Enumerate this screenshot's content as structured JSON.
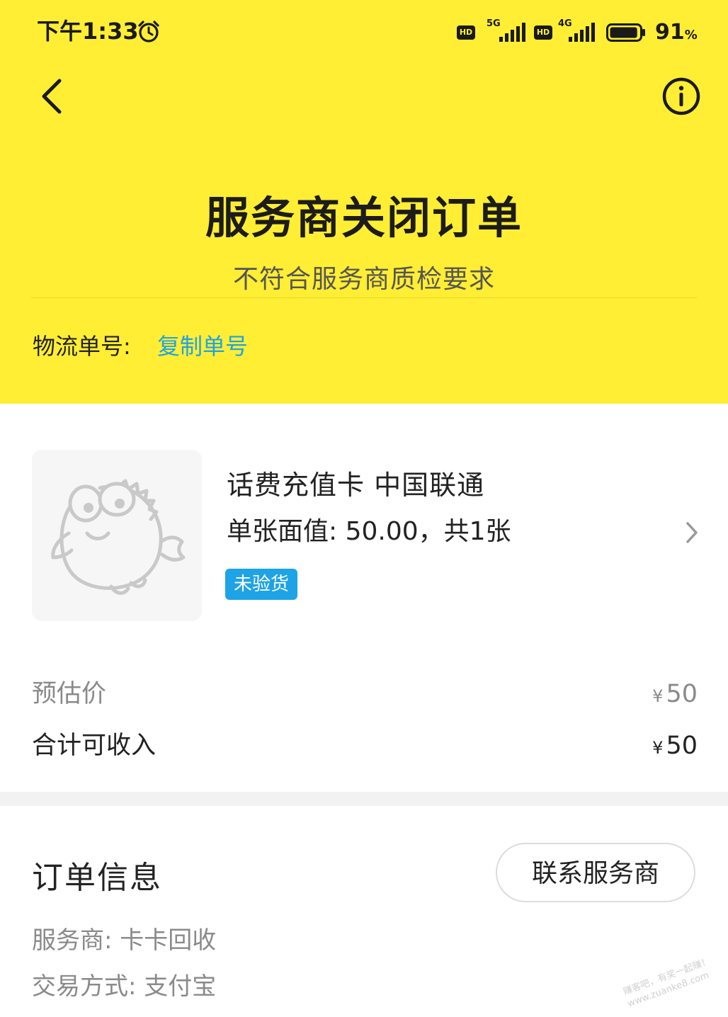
{
  "status_bar": {
    "time": "下午1:33",
    "network_1": "5G",
    "network_2": "4G",
    "hd_badge": "HD",
    "battery_percent": "91",
    "battery_unit": "%",
    "battery_level": 0.91
  },
  "header": {
    "title": "服务商关闭订单",
    "subtitle": "不符合服务商质检要求",
    "logistics_label": "物流单号:",
    "copy_label": "复制单号",
    "background_color": "#ffee33",
    "link_color": "#1ea3e6"
  },
  "product": {
    "name": "话费充值卡 中国联通",
    "description": "单张面值: 50.00，共1张",
    "status_badge": "未验货",
    "thumbnail_icon": "fish-mascot-placeholder-icon"
  },
  "pricing": {
    "estimate_label": "预估价",
    "estimate_currency": "¥",
    "estimate_value": "50",
    "total_label": "合计可收入",
    "total_currency": "¥",
    "total_value": "50"
  },
  "order_info": {
    "title": "订单信息",
    "contact_button": "联系服务商",
    "provider": "服务商: 卡卡回收",
    "payment_method": "交易方式: 支付宝"
  },
  "watermark": {
    "line1": "赚客吧，有奖一起赚！",
    "line2": "www.zuanke8.com"
  }
}
